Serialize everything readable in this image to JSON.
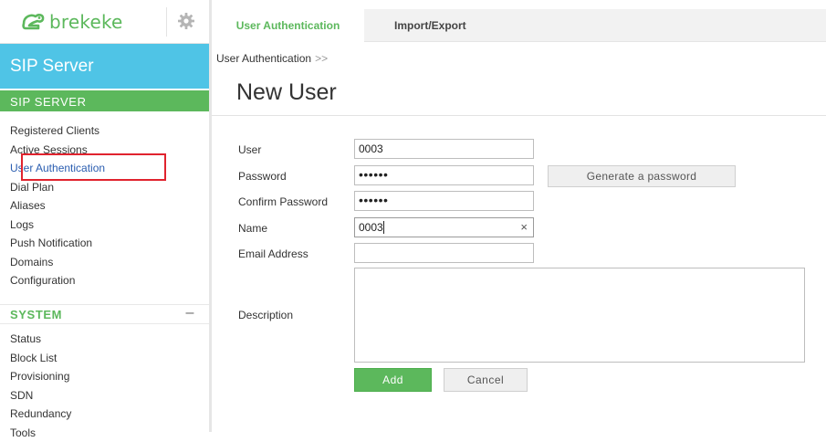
{
  "brand": {
    "logo_text": "brekeke",
    "product": "SIP Server",
    "accent_color": "#5cb85c",
    "header_color": "#4fc4e6"
  },
  "sidebar": {
    "sip_section": "SIP SERVER",
    "sip_items": [
      {
        "label": "Registered Clients"
      },
      {
        "label": "Active Sessions"
      },
      {
        "label": "User Authentication",
        "active": true
      },
      {
        "label": "Dial Plan"
      },
      {
        "label": "Aliases"
      },
      {
        "label": "Logs"
      },
      {
        "label": "Push Notification"
      },
      {
        "label": "Domains"
      },
      {
        "label": "Configuration"
      }
    ],
    "system_section": "SYSTEM",
    "system_toggle": "–",
    "system_items": [
      {
        "label": "Status"
      },
      {
        "label": "Block List"
      },
      {
        "label": "Provisioning"
      },
      {
        "label": "SDN"
      },
      {
        "label": "Redundancy"
      },
      {
        "label": "Tools"
      }
    ]
  },
  "tabs": [
    {
      "label": "User Authentication",
      "active": true
    },
    {
      "label": "Import/Export",
      "active": false
    }
  ],
  "breadcrumb": {
    "label": "User Authentication",
    "separator": ">>"
  },
  "page_title": "New User",
  "form": {
    "user": {
      "label": "User",
      "value": "0003"
    },
    "password": {
      "label": "Password",
      "value": "••••••"
    },
    "confirm_password": {
      "label": "Confirm Password",
      "value": "••••••"
    },
    "name": {
      "label": "Name",
      "value": "0003",
      "clear": "×"
    },
    "email": {
      "label": "Email Address",
      "value": ""
    },
    "description": {
      "label": "Description",
      "value": ""
    },
    "generate_button": "Generate a password",
    "add_button": "Add",
    "cancel_button": "Cancel"
  }
}
